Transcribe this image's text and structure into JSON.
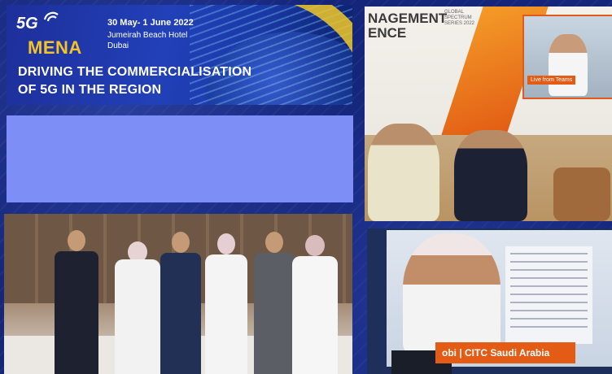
{
  "banner": {
    "logo_5g": "5G",
    "logo_mena": "MENA",
    "event_date": "30 May- 1 June 2022",
    "venue_line1": "Jumeirah Beach Hotel",
    "venue_line2": "Dubai",
    "headline_line1": "DRIVING THE COMMERCIALISATION",
    "headline_line2": "OF 5G IN THE REGION"
  },
  "stage_photo": {
    "screen_text_line1": "NAGEMENT",
    "screen_text_line2": "ENCE",
    "screen_small_text": "GLOBAL SPECTRUM SERIES 2022",
    "live_badge": "Live from Teams"
  },
  "speaker_photo": {
    "name_bar": "obi | CITC Saudi Arabia"
  },
  "colors": {
    "background": "#14257a",
    "banner_blue": "#2240b8",
    "mena_yellow": "#f5c227",
    "blank_block": "#7d8ff7",
    "accent_orange": "#e45b15"
  },
  "icons": {
    "logo_signal": "wifi-signal-icon"
  }
}
